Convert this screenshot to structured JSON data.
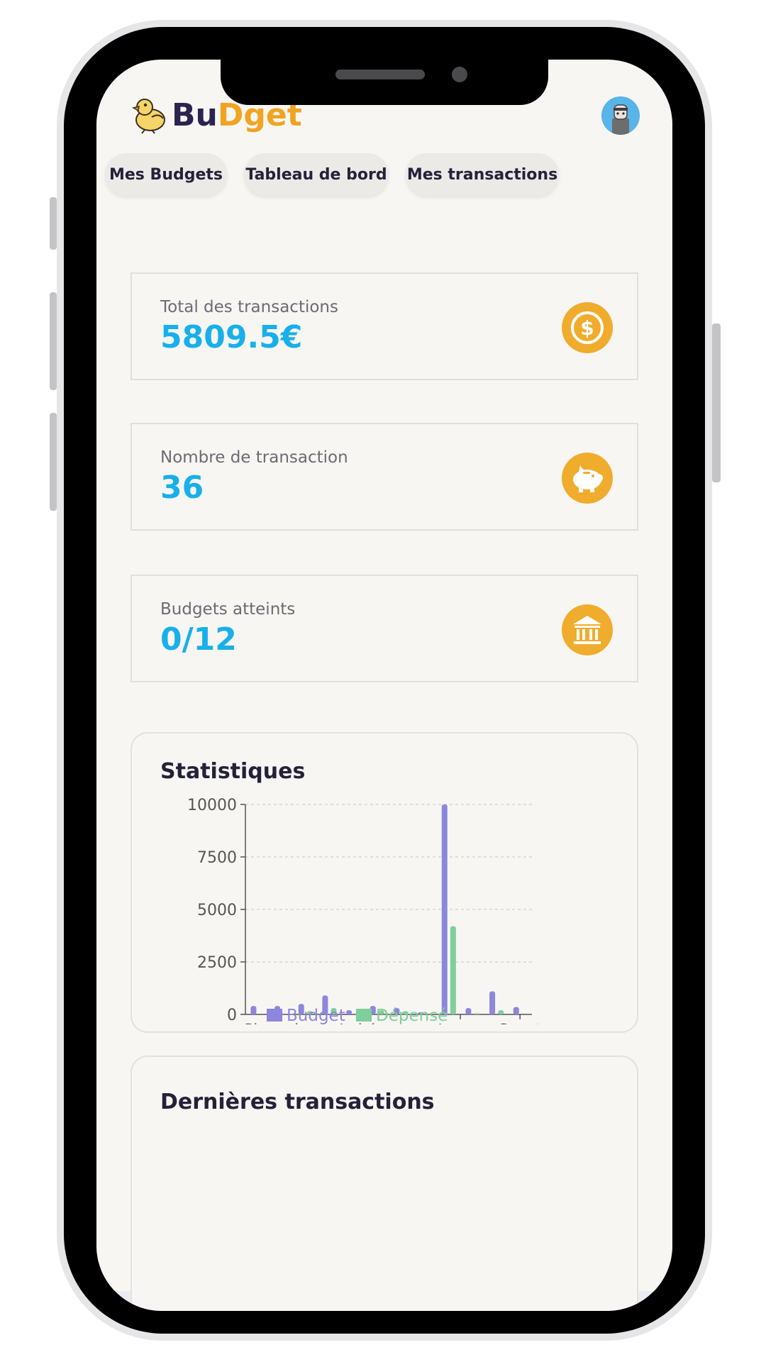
{
  "brand": {
    "part1": "Bu",
    "part2": "Dget"
  },
  "nav": {
    "budgets": "Mes Budgets",
    "dashboard": "Tableau de bord",
    "transactions": "Mes transactions"
  },
  "stats": [
    {
      "label": "Total des transactions",
      "value": "5809.5€",
      "icon": "dollar-coin-icon"
    },
    {
      "label": "Nombre de transaction",
      "value": "36",
      "icon": "piggy-bank-icon"
    },
    {
      "label": "Budgets atteints",
      "value": "0/12",
      "icon": "bank-icon"
    }
  ],
  "statistics": {
    "title": "Statistiques"
  },
  "latest": {
    "title": "Dernières transactions"
  },
  "colors": {
    "accent": "#18b0ea",
    "icon_bg": "#f0ac2c",
    "budget": "#8c86dd",
    "spent": "#7fcf9b",
    "brand_dark": "#2d2350",
    "brand_orange": "#f0a422"
  },
  "chart_data": {
    "type": "bar",
    "categories": [
      "Shopping",
      "",
      "",
      "Loisirs",
      "",
      "",
      "",
      "Loyer",
      "",
      "Sport"
    ],
    "series": [
      {
        "name": "Budget",
        "values": [
          400,
          400,
          500,
          900,
          200,
          400,
          300,
          100,
          10000,
          300,
          1100,
          350
        ]
      },
      {
        "name": "Dépensé",
        "values": [
          0,
          0,
          150,
          300,
          0,
          200,
          150,
          0,
          4200,
          50,
          200,
          0
        ]
      }
    ],
    "x_tick_labels": [
      "Shopping",
      "Loisirs",
      "Loyer",
      "Sport"
    ],
    "y_ticks": [
      "0",
      "2500",
      "5000",
      "7500",
      "10000"
    ],
    "ylim": [
      0,
      10000
    ],
    "legend": [
      "Budget",
      "Dépensé"
    ],
    "legend_placement": "bottom",
    "grid": true
  }
}
